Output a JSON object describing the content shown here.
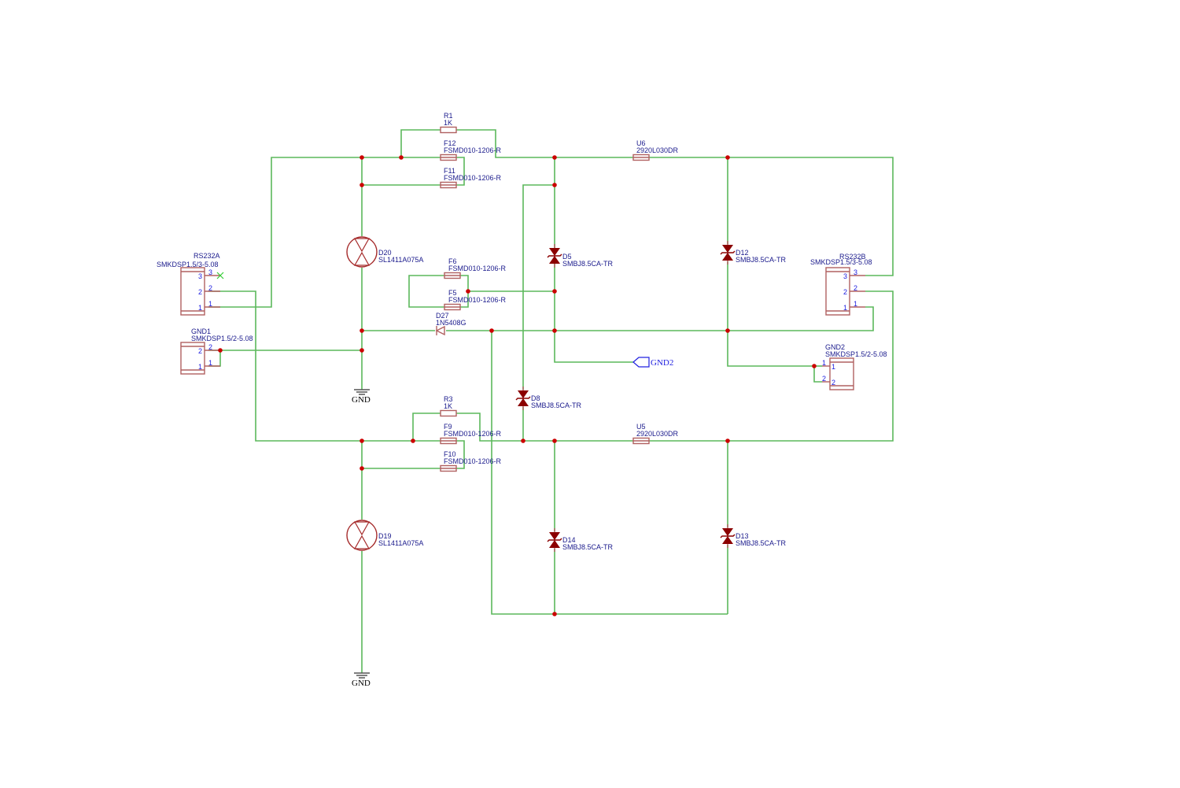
{
  "colors": {
    "wire": "#5cb85c",
    "component": "#a52a2a",
    "junction": "#cc0000",
    "label": "#1a1a8c",
    "pin": "#2020e0"
  },
  "components": {
    "R1": {
      "ref": "R1",
      "value": "1K"
    },
    "R3": {
      "ref": "R3",
      "value": "1K"
    },
    "F12": {
      "ref": "F12",
      "value": "FSMD010-1206-R"
    },
    "F11": {
      "ref": "F11",
      "value": "FSMD010-1206-R"
    },
    "F6": {
      "ref": "F6",
      "value": "FSMD010-1206-R"
    },
    "F5": {
      "ref": "F5",
      "value": "FSMD010-1206-R"
    },
    "F9": {
      "ref": "F9",
      "value": "FSMD010-1206-R"
    },
    "F10": {
      "ref": "F10",
      "value": "FSMD010-1206-R"
    },
    "U6": {
      "ref": "U6",
      "value": "2920L030DR"
    },
    "U5": {
      "ref": "U5",
      "value": "2920L030DR"
    },
    "D20": {
      "ref": "D20",
      "value": "SL1411A075A"
    },
    "D19": {
      "ref": "D19",
      "value": "SL1411A075A"
    },
    "D27": {
      "ref": "D27",
      "value": "1N5408G"
    },
    "D5": {
      "ref": "D5",
      "value": "SMBJ8.5CA-TR"
    },
    "D8": {
      "ref": "D8",
      "value": "SMBJ8.5CA-TR"
    },
    "D12": {
      "ref": "D12",
      "value": "SMBJ8.5CA-TR"
    },
    "D13": {
      "ref": "D13",
      "value": "SMBJ8.5CA-TR"
    },
    "D14": {
      "ref": "D14",
      "value": "SMBJ8.5CA-TR"
    },
    "RS232A": {
      "ref": "RS232A",
      "value": "SMKDSP1.5/3-5.08",
      "pins": [
        "1",
        "2",
        "3"
      ]
    },
    "RS232B": {
      "ref": "RS232B",
      "value": "SMKDSP1.5/3-5.08",
      "pins": [
        "1",
        "2",
        "3"
      ]
    },
    "GND1": {
      "ref": "GND1",
      "value": "SMKDSP1.5/2-5.08",
      "pins": [
        "1",
        "2"
      ]
    },
    "GND2": {
      "ref": "GND2",
      "value": "SMKDSP1.5/2-5.08",
      "pins": [
        "1",
        "2"
      ]
    }
  },
  "power": {
    "gnd_top": "GND",
    "gnd_bottom": "GND"
  },
  "ports": {
    "gnd2": "GND2"
  }
}
